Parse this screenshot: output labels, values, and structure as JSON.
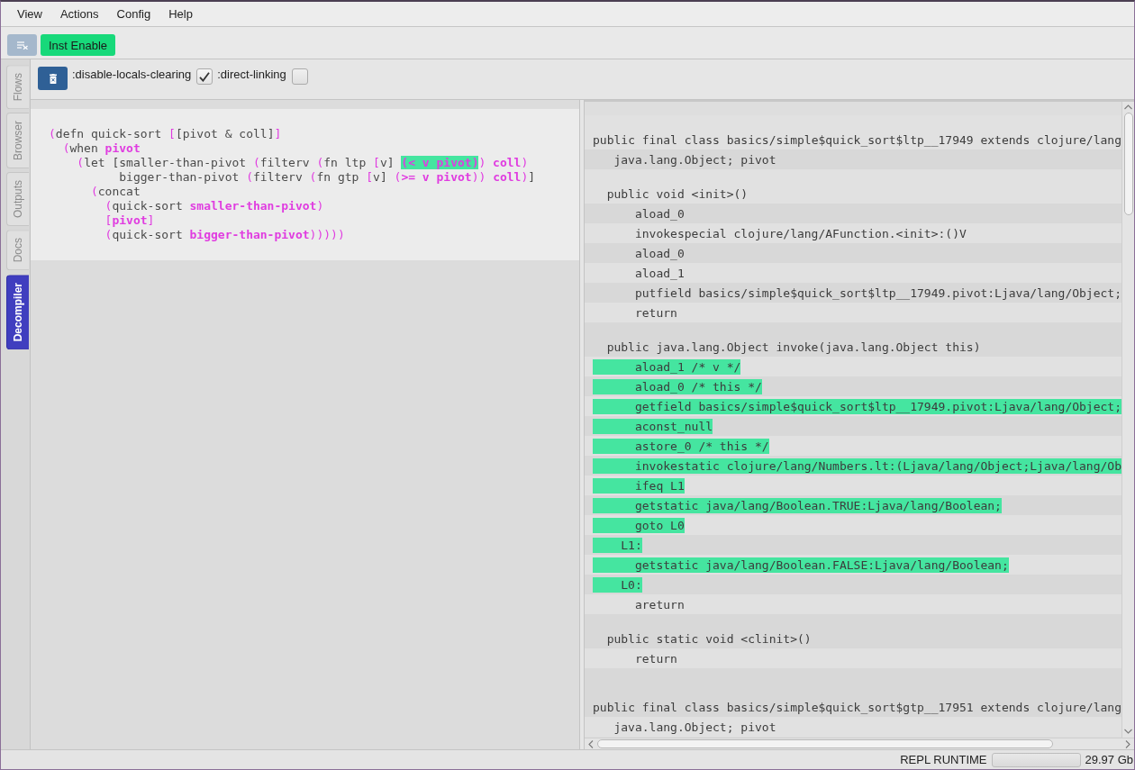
{
  "menu": [
    "View",
    "Actions",
    "Config",
    "Help"
  ],
  "toolbar": {
    "inst_button": "Inst Enable"
  },
  "side_tabs": [
    {
      "label": "Flows",
      "selected": false
    },
    {
      "label": "Browser",
      "selected": false
    },
    {
      "label": "Outputs",
      "selected": false
    },
    {
      "label": "Docs",
      "selected": false
    },
    {
      "label": "Decompiler",
      "selected": true
    }
  ],
  "options": [
    {
      "label": ":disable-locals-clearing",
      "checked": true
    },
    {
      "label": ":direct-linking",
      "checked": false
    }
  ],
  "editor": {
    "lines": [
      {
        "segments": [
          {
            "text": "(",
            "kind": "paren"
          },
          {
            "text": "defn quick-sort ",
            "kind": "plain"
          },
          {
            "text": "[",
            "kind": "paren"
          },
          {
            "text": "[pivot & coll]",
            "kind": "plain"
          },
          {
            "text": "]",
            "kind": "paren"
          }
        ]
      },
      {
        "segments": [
          {
            "text": "  (",
            "kind": "paren"
          },
          {
            "text": "when ",
            "kind": "plain"
          },
          {
            "text": "pivot",
            "kind": "bold"
          }
        ]
      },
      {
        "segments": [
          {
            "text": "    (",
            "kind": "paren"
          },
          {
            "text": "let [smaller-than-pivot ",
            "kind": "plain"
          },
          {
            "text": "(",
            "kind": "paren"
          },
          {
            "text": "filterv ",
            "kind": "plain"
          },
          {
            "text": "(",
            "kind": "paren"
          },
          {
            "text": "fn ltp ",
            "kind": "plain"
          },
          {
            "text": "[",
            "kind": "paren"
          },
          {
            "text": "v] ",
            "kind": "plain"
          },
          {
            "text": "(< v pivot)",
            "kind": "match"
          },
          {
            "text": ") ",
            "kind": "paren"
          },
          {
            "text": "coll",
            "kind": "bold"
          },
          {
            "text": ")",
            "kind": "paren"
          }
        ]
      },
      {
        "segments": [
          {
            "text": "          bigger-than-pivot ",
            "kind": "plain"
          },
          {
            "text": "(",
            "kind": "paren"
          },
          {
            "text": "filterv ",
            "kind": "plain"
          },
          {
            "text": "(",
            "kind": "paren"
          },
          {
            "text": "fn gtp ",
            "kind": "plain"
          },
          {
            "text": "[",
            "kind": "paren"
          },
          {
            "text": "v] ",
            "kind": "plain"
          },
          {
            "text": "(",
            "kind": "paren"
          },
          {
            "text": ">= v pivot",
            "kind": "bold"
          },
          {
            "text": ")) ",
            "kind": "paren"
          },
          {
            "text": "coll",
            "kind": "bold"
          },
          {
            "text": ")",
            "kind": "paren"
          },
          {
            "text": "]",
            "kind": "plain"
          }
        ]
      },
      {
        "segments": [
          {
            "text": "      (",
            "kind": "paren"
          },
          {
            "text": "concat",
            "kind": "plain"
          }
        ]
      },
      {
        "segments": [
          {
            "text": "        (",
            "kind": "paren"
          },
          {
            "text": "quick-sort ",
            "kind": "plain"
          },
          {
            "text": "smaller-than-pivot",
            "kind": "bold"
          },
          {
            "text": ")",
            "kind": "paren"
          }
        ]
      },
      {
        "segments": [
          {
            "text": "        [",
            "kind": "paren"
          },
          {
            "text": "pivot",
            "kind": "bold"
          },
          {
            "text": "]",
            "kind": "paren"
          }
        ]
      },
      {
        "segments": [
          {
            "text": "        (",
            "kind": "paren"
          },
          {
            "text": "quick-sort ",
            "kind": "plain"
          },
          {
            "text": "bigger-than-pivot",
            "kind": "bold"
          },
          {
            "text": ")))))",
            "kind": "paren"
          }
        ]
      }
    ]
  },
  "bytecode": {
    "classes": [
      {
        "declaration": "public final class basics/simple$quick_sort$ltp__17949 extends clojure/lang",
        "fields": [
          "java.lang.Object; pivot"
        ],
        "methods": [
          {
            "signature": "public void <init>()",
            "instructions": [
              {
                "text": "aload_0",
                "kind": "op",
                "highlighted": false
              },
              {
                "text": "invokespecial clojure/lang/AFunction.<init>:()V",
                "kind": "op",
                "highlighted": false
              },
              {
                "text": "aload_0",
                "kind": "op",
                "highlighted": false
              },
              {
                "text": "aload_1",
                "kind": "op",
                "highlighted": false
              },
              {
                "text": "putfield basics/simple$quick_sort$ltp__17949.pivot:Ljava/lang/Object;",
                "kind": "op",
                "highlighted": false
              },
              {
                "text": "return",
                "kind": "op",
                "highlighted": false
              }
            ]
          },
          {
            "signature": "public java.lang.Object invoke(java.lang.Object this)",
            "instructions": [
              {
                "text": "aload_1 /* v */",
                "kind": "op",
                "highlighted": true
              },
              {
                "text": "aload_0 /* this */",
                "kind": "op",
                "highlighted": true
              },
              {
                "text": "getfield basics/simple$quick_sort$ltp__17949.pivot:Ljava/lang/Object;",
                "kind": "op",
                "highlighted": true
              },
              {
                "text": "aconst_null",
                "kind": "op",
                "highlighted": true
              },
              {
                "text": "astore_0 /* this */",
                "kind": "op",
                "highlighted": true
              },
              {
                "text": "invokestatic clojure/lang/Numbers.lt:(Ljava/lang/Object;Ljava/lang/Ob",
                "kind": "op",
                "highlighted": true
              },
              {
                "text": "ifeq L1",
                "kind": "op",
                "highlighted": true
              },
              {
                "text": "getstatic java/lang/Boolean.TRUE:Ljava/lang/Boolean;",
                "kind": "op",
                "highlighted": true
              },
              {
                "text": "goto L0",
                "kind": "op",
                "highlighted": true
              },
              {
                "text": "L1:",
                "kind": "label",
                "highlighted": true
              },
              {
                "text": "getstatic java/lang/Boolean.FALSE:Ljava/lang/Boolean;",
                "kind": "op",
                "highlighted": true
              },
              {
                "text": "L0:",
                "kind": "label",
                "highlighted": true
              },
              {
                "text": "areturn",
                "kind": "op",
                "highlighted": false
              }
            ]
          },
          {
            "signature": "public static void <clinit>()",
            "instructions": [
              {
                "text": "return",
                "kind": "op",
                "highlighted": false
              }
            ]
          }
        ]
      },
      {
        "declaration": "public final class basics/simple$quick_sort$gtp__17951 extends clojure/lang",
        "fields": [
          "java.lang.Object; pivot"
        ]
      }
    ]
  },
  "status_bar": {
    "label": "REPL RUNTIME",
    "memory": "29.97 Gb"
  }
}
